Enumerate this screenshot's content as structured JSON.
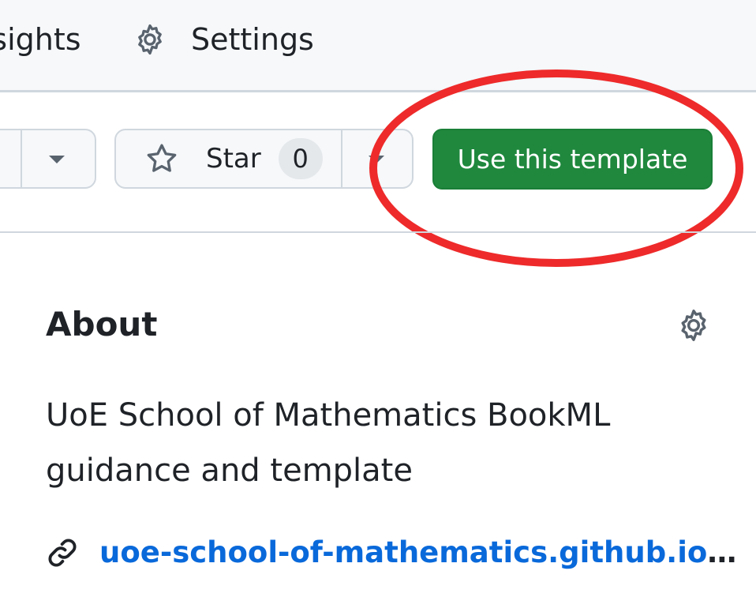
{
  "topnav": {
    "insights_label": "Insights",
    "settings_label": "Settings",
    "settings_icon": "gear-icon"
  },
  "actions": {
    "star_label": "Star",
    "star_count": "0",
    "star_icon": "star-icon",
    "template_button_label": "Use this template",
    "template_button_color": "#1f883d",
    "highlight_color": "#ee2a2a"
  },
  "about": {
    "heading": "About",
    "description": "UoE School of Mathematics BookML guidance and template",
    "link_text": "uoe-school-of-mathematics.github.io",
    "link_ellipsis": "…",
    "link_icon": "link-icon",
    "settings_icon": "gear-icon"
  },
  "colors": {
    "link": "#0969da",
    "text": "#1f2328",
    "border": "#d0d7de",
    "nav_bg": "#f6f8fa"
  }
}
